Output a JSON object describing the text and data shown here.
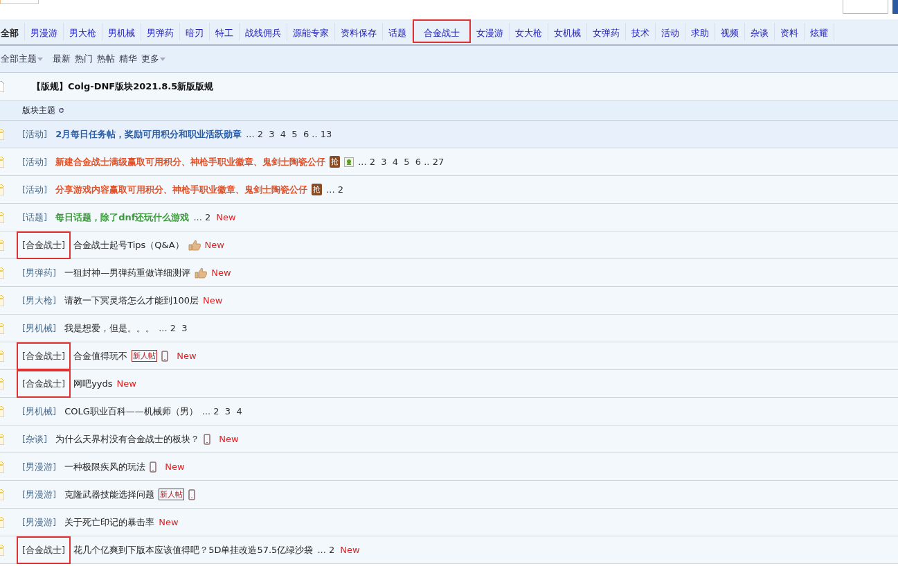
{
  "tabs": [
    {
      "label": "全部",
      "selected": true,
      "highlighted": false
    },
    {
      "label": "男漫游",
      "selected": false,
      "highlighted": false
    },
    {
      "label": "男大枪",
      "selected": false,
      "highlighted": false
    },
    {
      "label": "男机械",
      "selected": false,
      "highlighted": false
    },
    {
      "label": "男弹药",
      "selected": false,
      "highlighted": false
    },
    {
      "label": "暗刃",
      "selected": false,
      "highlighted": false
    },
    {
      "label": "特工",
      "selected": false,
      "highlighted": false
    },
    {
      "label": "战线佣兵",
      "selected": false,
      "highlighted": false
    },
    {
      "label": "源能专家",
      "selected": false,
      "highlighted": false
    },
    {
      "label": "资料保存",
      "selected": false,
      "highlighted": false
    },
    {
      "label": "话题",
      "selected": false,
      "highlighted": false
    },
    {
      "label": "合金战士",
      "selected": false,
      "highlighted": true
    },
    {
      "label": "女漫游",
      "selected": false,
      "highlighted": false
    },
    {
      "label": "女大枪",
      "selected": false,
      "highlighted": false
    },
    {
      "label": "女机械",
      "selected": false,
      "highlighted": false
    },
    {
      "label": "女弹药",
      "selected": false,
      "highlighted": false
    },
    {
      "label": "技术",
      "selected": false,
      "highlighted": false
    },
    {
      "label": "活动",
      "selected": false,
      "highlighted": false
    },
    {
      "label": "求助",
      "selected": false,
      "highlighted": false
    },
    {
      "label": "视频",
      "selected": false,
      "highlighted": false
    },
    {
      "label": "杂谈",
      "selected": false,
      "highlighted": false
    },
    {
      "label": "资料",
      "selected": false,
      "highlighted": false
    },
    {
      "label": "炫耀",
      "selected": false,
      "highlighted": false
    }
  ],
  "filters": [
    {
      "label": "全部主题",
      "dropdown": true
    },
    {
      "label": "最新",
      "dropdown": false
    },
    {
      "label": "热门",
      "dropdown": false
    },
    {
      "label": "热帖",
      "dropdown": false
    },
    {
      "label": "精华",
      "dropdown": false
    },
    {
      "label": "更多",
      "dropdown": true
    }
  ],
  "sticky_title": "【版规】Colg-DNF版块2021.8.5新版版规",
  "section_label": "版块主题",
  "threads": [
    {
      "prefix": "[活动]",
      "title": "2月每日任务帖，奖励可用积分和职业活跃勋章",
      "kind": "blue",
      "pages": "... 2  3  4  5  6 .. 13",
      "highlighted": false
    },
    {
      "prefix": "[活动]",
      "title": "新建合金战士满级赢取可用积分、神枪手职业徽章、鬼剑士陶瓷公仔",
      "kind": "orange",
      "badges": [
        {
          "kind": "grab",
          "text": "抢"
        },
        {
          "kind": "image"
        }
      ],
      "pages": "... 2  3  4  5  6 .. 27",
      "highlighted": false
    },
    {
      "prefix": "[活动]",
      "title": "分享游戏内容赢取可用积分、神枪手职业徽章、鬼剑士陶瓷公仔",
      "kind": "orange",
      "badges": [
        {
          "kind": "grab",
          "text": "抢"
        }
      ],
      "pages": "... 2",
      "highlighted": false
    },
    {
      "prefix": "[话题]",
      "title": "每日话题，除了dnf还玩什么游戏",
      "kind": "green",
      "pages": "... 2",
      "new": "New",
      "highlighted": false
    },
    {
      "prefix": "[合金战士]",
      "title": "合金战士起号Tips（Q&A）",
      "kind": "normal",
      "badges": [
        {
          "kind": "thumb"
        }
      ],
      "new": "New",
      "highlighted": true
    },
    {
      "prefix": "[男弹药]",
      "title": "一狙封神—男弹药重做详细测评",
      "kind": "normal",
      "badges": [
        {
          "kind": "thumb"
        }
      ],
      "new": "New",
      "highlighted": false
    },
    {
      "prefix": "[男大枪]",
      "title": "请教一下冥灵塔怎么才能到100层",
      "kind": "normal",
      "new": "New",
      "highlighted": false
    },
    {
      "prefix": "[男机械]",
      "title": "我是想爱，但是。。。",
      "kind": "normal",
      "pages": "... 2  3",
      "highlighted": false
    },
    {
      "prefix": "[合金战士]",
      "title": "合金值得玩不",
      "kind": "normal",
      "badges": [
        {
          "kind": "newbie",
          "text": "新人帖"
        },
        {
          "kind": "phone"
        }
      ],
      "new": "New",
      "highlighted": true
    },
    {
      "prefix": "[合金战士]",
      "title": "网吧yyds",
      "kind": "normal",
      "new": "New",
      "highlighted": true
    },
    {
      "prefix": "[男机械]",
      "title": "COLG职业百科——机械师（男）",
      "kind": "normal",
      "pages": "... 2  3  4",
      "highlighted": false
    },
    {
      "prefix": "[杂谈]",
      "title": "为什么天界村没有合金战士的板块？",
      "kind": "normal",
      "badges": [
        {
          "kind": "phone"
        }
      ],
      "new": "New",
      "highlighted": false
    },
    {
      "prefix": "[男漫游]",
      "title": "一种极限疾风的玩法",
      "kind": "normal",
      "badges": [
        {
          "kind": "phone"
        }
      ],
      "new": "New",
      "highlighted": false
    },
    {
      "prefix": "[男漫游]",
      "title": "克隆武器技能选择问题",
      "kind": "normal",
      "badges": [
        {
          "kind": "newbie",
          "text": "新人帖"
        },
        {
          "kind": "phone"
        }
      ],
      "highlighted": false
    },
    {
      "prefix": "[男漫游]",
      "title": "关于死亡印记的暴击率",
      "kind": "normal",
      "new": "New",
      "highlighted": false
    },
    {
      "prefix": "[合金战士]",
      "title": "花几个亿爽到下版本应该值得吧？5D单挂改造57.5亿绿沙袋",
      "kind": "normal",
      "pages": "... 2",
      "new": "New",
      "highlighted": true
    }
  ]
}
